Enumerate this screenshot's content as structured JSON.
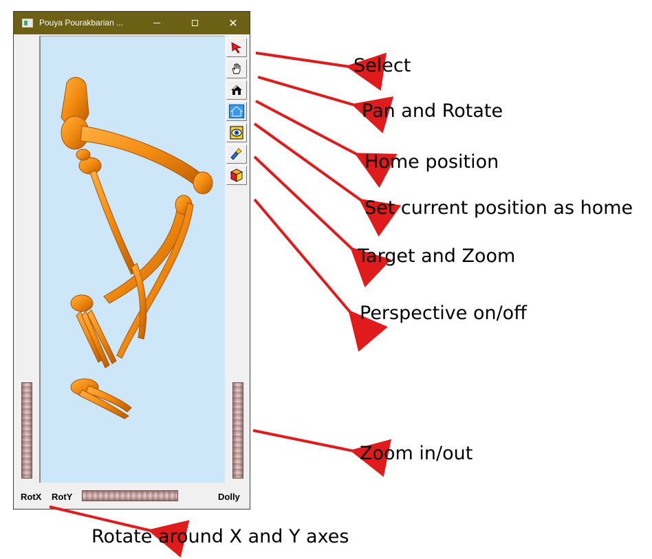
{
  "window": {
    "title": "Pouya Pourakbarian ...",
    "minimize_icon": "minimize-icon",
    "maximize_icon": "maximize-icon",
    "close_glyph": "✕"
  },
  "viewer": {
    "background_color": "#cde6f8",
    "model_color": "#f28a10",
    "model": "skeleton-leg-model"
  },
  "toolbar": [
    {
      "name": "select-button",
      "icon": "arrow-cursor-icon"
    },
    {
      "name": "pan-rotate-button",
      "icon": "hand-icon"
    },
    {
      "name": "home-button",
      "icon": "house-icon"
    },
    {
      "name": "set-home-button",
      "icon": "house-outline-icon",
      "active": true
    },
    {
      "name": "target-zoom-button",
      "icon": "eye-target-icon"
    },
    {
      "name": "perspective-button",
      "icon": "flashlight-icon"
    },
    {
      "name": "view-cube-button",
      "icon": "cube-icon"
    }
  ],
  "thumbwheels": {
    "rotx_label": "RotX",
    "roty_label": "RotY",
    "dolly_label": "Dolly"
  },
  "annotations": {
    "select": "Select",
    "pan_rotate": "Pan and Rotate",
    "home": "Home position",
    "set_home": "Set current position as home",
    "target_zoom": "Target and Zoom",
    "perspective": "Perspective on/off",
    "zoom": "Zoom in/out",
    "rotate_xy": "Rotate around X and Y axes"
  },
  "colors": {
    "titlebar": "#6b6014",
    "arrow": "#e01b1b"
  }
}
